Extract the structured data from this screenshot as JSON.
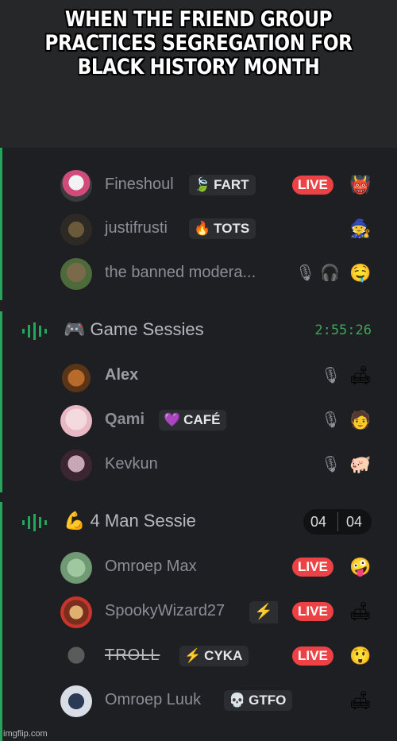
{
  "meme": {
    "caption": "WHEN THE FRIEND GROUP PRACTICES SEGREGATION FOR BLACK HISTORY MONTH",
    "watermark": "imgflip.com"
  },
  "channels": [
    {
      "title": "",
      "members": [
        {
          "name": "Fineshoul",
          "tag_icon": "🍃",
          "tag": "FART",
          "live": "LIVE",
          "status": "👹"
        },
        {
          "name": "justifrusti",
          "tag_icon": "🔥",
          "tag": "TOTS",
          "status": "🧙"
        },
        {
          "name": "the banned modera...",
          "status": "🤤",
          "muted_icons": "🎙 🎧"
        }
      ]
    },
    {
      "emoji": "🎮",
      "title": "Game Sessies",
      "timer": "2:55:26",
      "members": [
        {
          "name": "Alex",
          "status": "🛋"
        },
        {
          "name": "Qami",
          "tag_icon": "💜",
          "tag": "CAFÉ",
          "status": "🧑"
        },
        {
          "name": "Kevkun",
          "status": "🐖"
        }
      ]
    },
    {
      "emoji": "💪",
      "title": "4 Man Sessie",
      "counter_left": "04",
      "counter_right": "04",
      "members": [
        {
          "name": "Omroep Max",
          "live": "LIVE",
          "status": "🤪"
        },
        {
          "name": "SpookyWizard27",
          "streak": "⚡",
          "live": "LIVE",
          "status": "🛋"
        },
        {
          "name": "TROLL",
          "tag_icon": "⚡",
          "tag": "CYKA",
          "live": "LIVE",
          "status": "😲"
        },
        {
          "name": "Omroep Luuk",
          "tag_icon": "💀",
          "tag": "GTFO",
          "status": "🛋"
        }
      ]
    }
  ],
  "colors": {
    "live": "#ed4245",
    "voice_green": "#23a55a",
    "bg": "#1e1f22"
  }
}
